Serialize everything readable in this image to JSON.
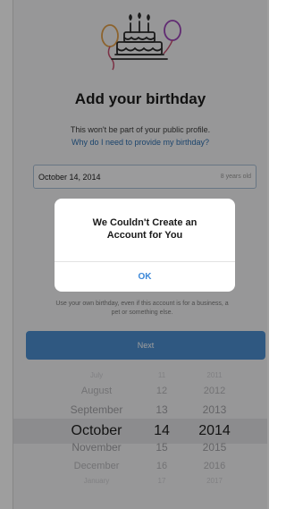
{
  "signup": {
    "title": "Add your birthday",
    "subtitle": "This won't be part of your public profile.",
    "why_link": "Why do I need to provide my birthday?",
    "date_field": {
      "value": "October 14, 2014",
      "age": "8 years old"
    },
    "note_line1": "Use your own birthday, even if this account is for a business, a",
    "note_line2": "pet or something else.",
    "next_label": "Next",
    "illustration": "birthday-cake-with-balloons"
  },
  "picker": {
    "rows": [
      {
        "month": "July",
        "day": "11",
        "year": "2011"
      },
      {
        "month": "August",
        "day": "12",
        "year": "2012"
      },
      {
        "month": "September",
        "day": "13",
        "year": "2013"
      },
      {
        "month": "October",
        "day": "14",
        "year": "2014"
      },
      {
        "month": "November",
        "day": "15",
        "year": "2015"
      },
      {
        "month": "December",
        "day": "16",
        "year": "2016"
      },
      {
        "month": "January",
        "day": "17",
        "year": "2017"
      }
    ],
    "selected_index": 3
  },
  "dialog": {
    "title_line1": "We Couldn't Create an",
    "title_line2": "Account for You",
    "ok_label": "OK"
  },
  "colors": {
    "primary_button": "#4d8fd0",
    "link": "#2d6fb0",
    "dialog_action": "#3b87d8",
    "overlay": "rgba(0,0,0,0.38)"
  }
}
